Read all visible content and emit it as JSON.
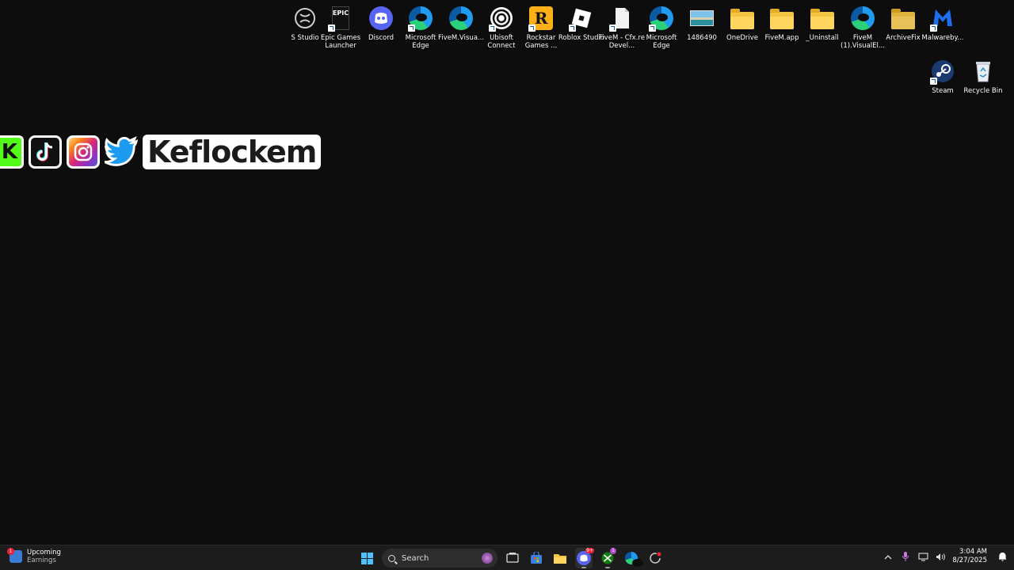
{
  "desktop": {
    "icons_top": [
      {
        "label": "S Studio"
      },
      {
        "label": "Epic Games Launcher",
        "logo_text": "EPIC"
      },
      {
        "label": "Discord"
      },
      {
        "label": "Microsoft Edge"
      },
      {
        "label": "FiveM.Visua..."
      },
      {
        "label": "Ubisoft Connect"
      },
      {
        "label": "Rockstar Games ...",
        "logo_text": "R"
      },
      {
        "label": "Roblox Studio"
      },
      {
        "label": "FiveM - Cfx.re Devel..."
      },
      {
        "label": "Microsoft Edge"
      },
      {
        "label": "1486490"
      },
      {
        "label": "OneDrive"
      },
      {
        "label": "FiveM.app"
      },
      {
        "label": "_Uninstall"
      },
      {
        "label": "FiveM (1).VisualEl..."
      },
      {
        "label": "ArchiveFix"
      },
      {
        "label": "Malwareby..."
      }
    ],
    "icons_right": [
      {
        "label": "Steam"
      },
      {
        "label": "Recycle Bin"
      }
    ]
  },
  "banner": {
    "name": "Keflockem",
    "kick_letter": "K"
  },
  "taskbar": {
    "widget": {
      "title": "Upcoming",
      "subtitle": "Earnings",
      "badge": "1"
    },
    "search_placeholder": "Search",
    "clock_time": "3:04 AM",
    "clock_date": "8/27/2025",
    "discord_badge": "9+",
    "xbox_badge": "1"
  },
  "colors": {
    "background": "#0d0d0d",
    "taskbar": "#1c1c1c",
    "windows_blue": "#4cc2ff",
    "folder": "#f4c542",
    "discord": "#5865f2",
    "kick_green": "#53fc18",
    "twitter_blue": "#1d9bf0"
  }
}
